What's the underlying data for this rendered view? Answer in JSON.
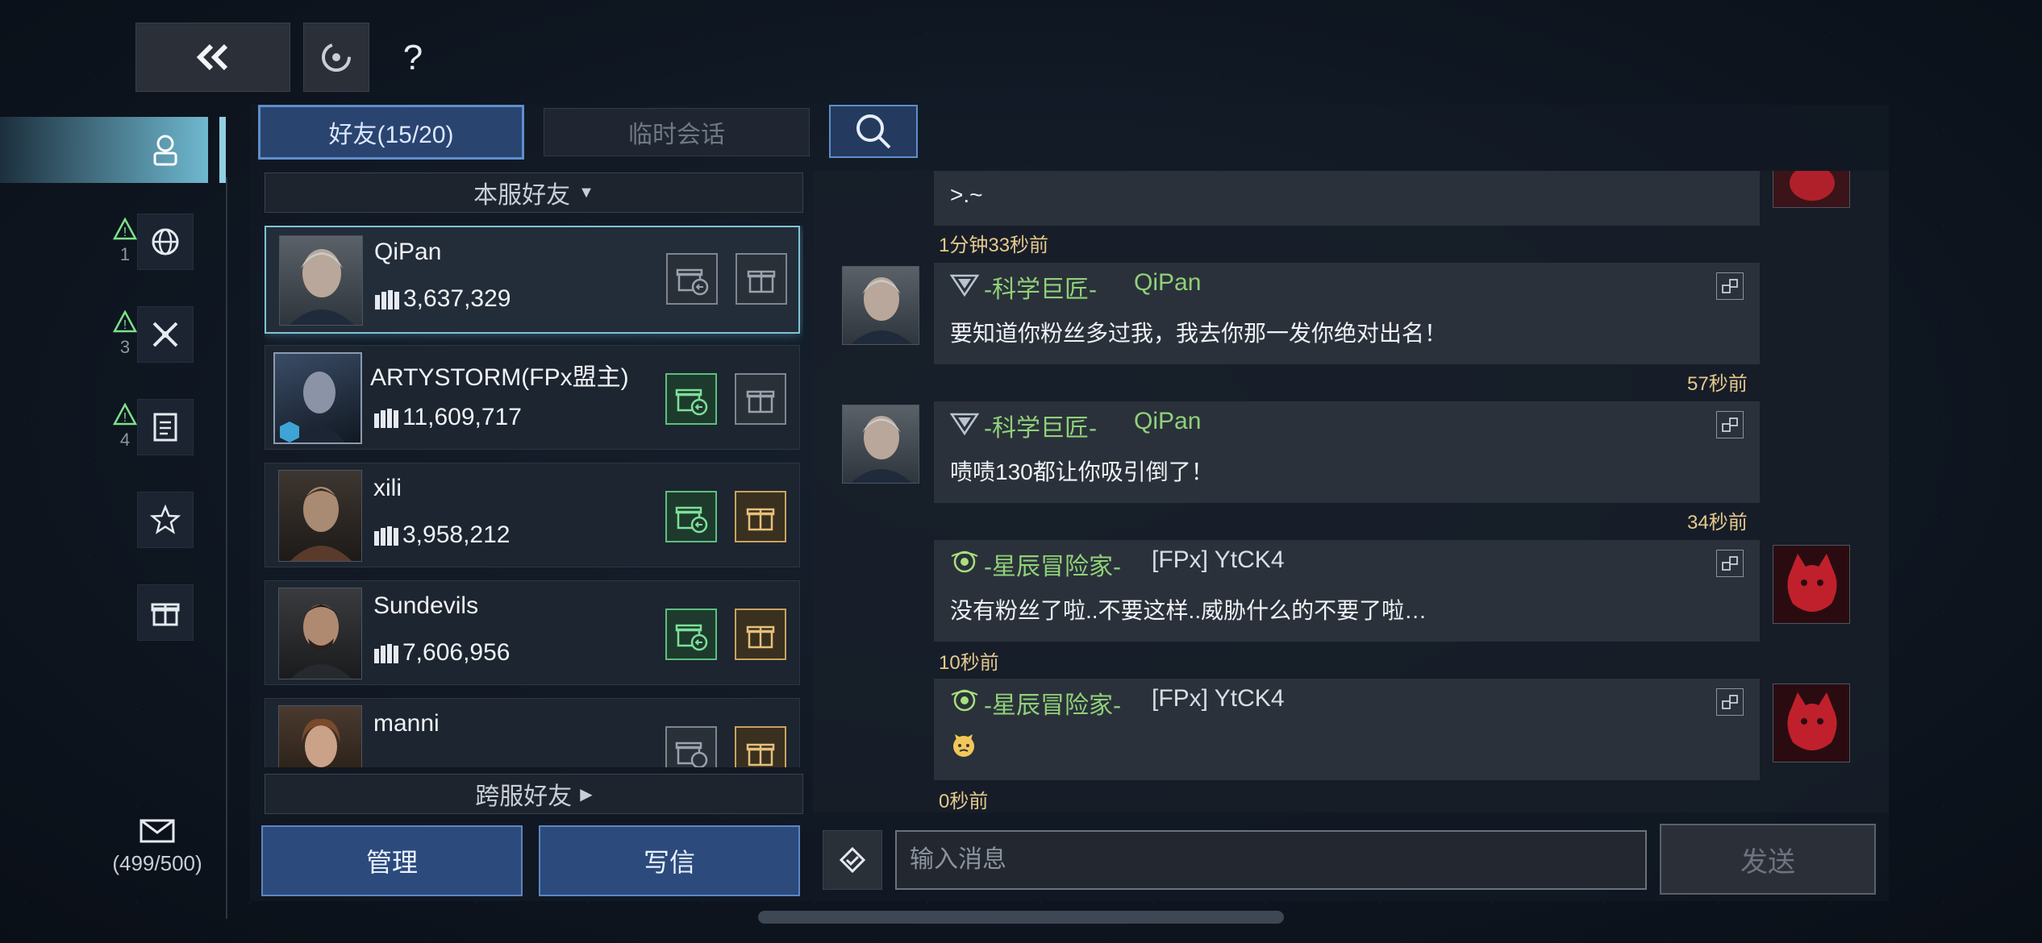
{
  "topbar": {
    "help_label": "?"
  },
  "sidebar": {
    "items": [
      {
        "name": "friends",
        "badge": ""
      },
      {
        "name": "globe",
        "badge": "1"
      },
      {
        "name": "battle",
        "badge": "3"
      },
      {
        "name": "notes",
        "badge": "4"
      },
      {
        "name": "favorites",
        "badge": ""
      },
      {
        "name": "gifts",
        "badge": ""
      }
    ],
    "mail_count": "(499/500)"
  },
  "tabs": {
    "friends": "好友(15/20)",
    "temp": "临时会话"
  },
  "friends_panel": {
    "server_filter": "本服好友",
    "cross_server": "跨服好友",
    "manage": "管理",
    "write": "写信",
    "list": [
      {
        "name": "QiPan",
        "power": "3,637,329",
        "selected": true
      },
      {
        "name": "ARTYSTORM(FPx盟主)",
        "power": "11,609,717",
        "selected": false
      },
      {
        "name": "xili",
        "power": "3,958,212",
        "selected": false
      },
      {
        "name": "Sundevils",
        "power": "7,606,956",
        "selected": false
      },
      {
        "name": "manni",
        "power": "",
        "selected": false
      }
    ]
  },
  "chat": {
    "messages": [
      {
        "side": "right",
        "title": "",
        "sender": "",
        "text": ">.~",
        "time": "1分钟33秒前"
      },
      {
        "side": "left",
        "title": "-科学巨匠-",
        "sender": "QiPan",
        "text": "要知道你粉丝多过我，我去你那一发你绝对出名！",
        "time": "57秒前"
      },
      {
        "side": "left",
        "title": "-科学巨匠-",
        "sender": "QiPan",
        "text": "啧啧130都让你吸引倒了！",
        "time": "34秒前"
      },
      {
        "side": "right",
        "title": "-星辰冒险家-",
        "sender": "[FPx] YtCK4",
        "text": "没有粉丝了啦..不要这样..威胁什么的不要了啦…",
        "time": "10秒前"
      },
      {
        "side": "right",
        "title": "-星辰冒险家-",
        "sender": "[FPx] YtCK4",
        "text": "",
        "time": "0秒前"
      }
    ],
    "input_placeholder": "输入消息",
    "send": "发送"
  }
}
